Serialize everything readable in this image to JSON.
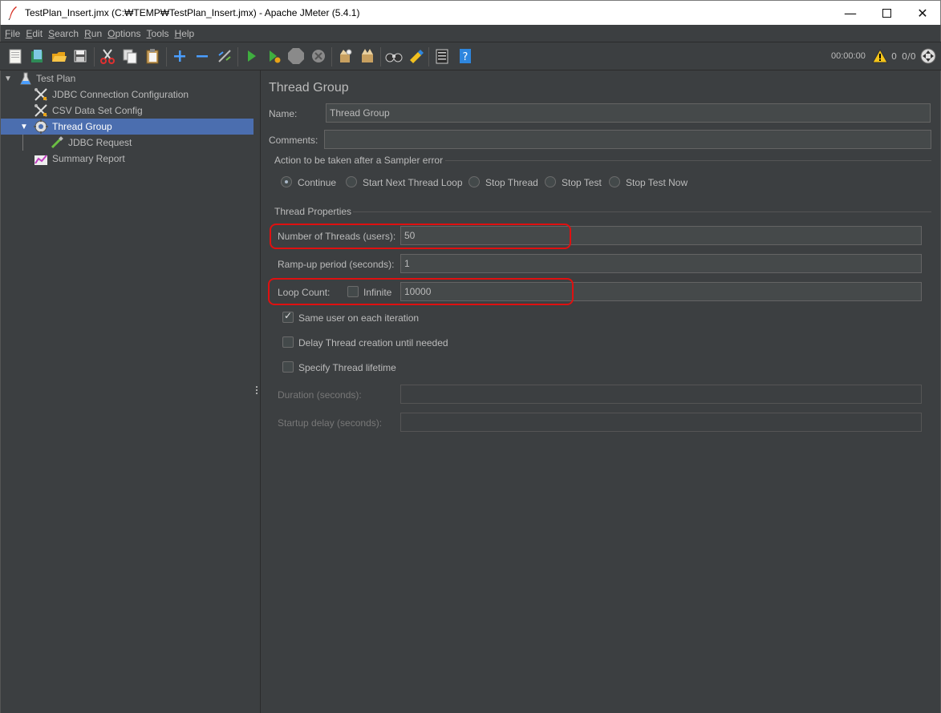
{
  "window": {
    "title": "TestPlan_Insert.jmx (C:₩TEMP₩TestPlan_Insert.jmx) - Apache JMeter (5.4.1)",
    "min_glyph": "—",
    "close_glyph": "✕"
  },
  "menu": [
    {
      "mnemonic": "F",
      "rest": "ile"
    },
    {
      "mnemonic": "E",
      "rest": "dit"
    },
    {
      "mnemonic": "S",
      "rest": "earch"
    },
    {
      "mnemonic": "R",
      "rest": "un"
    },
    {
      "mnemonic": "O",
      "rest": "ptions"
    },
    {
      "mnemonic": "T",
      "rest": "ools"
    },
    {
      "mnemonic": "H",
      "rest": "elp"
    }
  ],
  "toolbar": {
    "icons": [
      "new-icon",
      "templates-icon",
      "open-icon",
      "save-icon",
      "cut-icon",
      "copy-icon",
      "paste-icon",
      "expand-icon",
      "collapse-icon",
      "toggle-icon",
      "start-icon",
      "start-no-pauses-icon",
      "stop-icon",
      "shutdown-icon",
      "clear-icon",
      "clear-all-icon",
      "search-icon",
      "reset-search-icon",
      "function-helper-icon",
      "help-icon"
    ],
    "timer": "00:00:00",
    "warning_count": "0",
    "threads": "0/0"
  },
  "tree": {
    "items": [
      {
        "label": "Test Plan",
        "icon": "flask-icon"
      },
      {
        "label": "JDBC Connection Configuration",
        "icon": "wrench-icon"
      },
      {
        "label": "CSV Data Set Config",
        "icon": "wrench-icon"
      },
      {
        "label": "Thread Group",
        "icon": "gear-icon"
      },
      {
        "label": "JDBC Request",
        "icon": "pipette-icon"
      },
      {
        "label": "Summary Report",
        "icon": "report-icon"
      }
    ]
  },
  "main": {
    "title": "Thread Group",
    "name_label": "Name:",
    "name_value": "Thread Group",
    "comments_label": "Comments:",
    "comments_value": "",
    "sampler_error_group": "Action to be taken after a Sampler error",
    "sampler_error_options": [
      "Continue",
      "Start Next Thread Loop",
      "Stop Thread",
      "Stop Test",
      "Stop Test Now"
    ],
    "sampler_error_selected": "Continue",
    "thread_props_group": "Thread Properties",
    "num_threads_label": "Number of Threads (users):",
    "num_threads_value": "50",
    "rampup_label": "Ramp-up period (seconds):",
    "rampup_value": "1",
    "loop_count_label": "Loop Count:",
    "infinite_label": "Infinite",
    "infinite_checked": false,
    "loop_count_value": "10000",
    "same_user_label": "Same user on each iteration",
    "same_user_checked": true,
    "delay_label": "Delay Thread creation until needed",
    "delay_checked": false,
    "lifetime_label": "Specify Thread lifetime",
    "lifetime_checked": false,
    "duration_label": "Duration (seconds):",
    "duration_value": "",
    "startup_delay_label": "Startup delay (seconds):",
    "startup_delay_value": ""
  },
  "colors": {
    "background": "#3c3f41",
    "selection": "#4b6eaf",
    "highlight": "#e01010"
  }
}
